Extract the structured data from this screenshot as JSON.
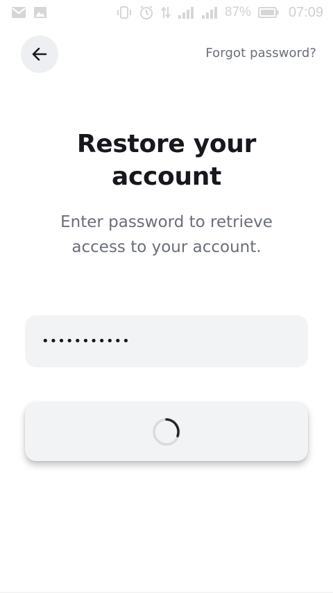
{
  "status_bar": {
    "battery_text": "87%",
    "time": "07:09",
    "icons": [
      "gmail-icon",
      "gallery-icon",
      "vibrate-icon",
      "alarm-icon",
      "data-arrows-icon",
      "signal-icon",
      "signal-icon-2",
      "battery-icon"
    ]
  },
  "header": {
    "back_icon": "arrow-left-icon",
    "forgot_label": "Forgot password?"
  },
  "main": {
    "title": "Restore your account",
    "subtitle": "Enter password to retrieve access to your account.",
    "password_value": "•••••••••••",
    "submit_state": "loading"
  },
  "colors": {
    "title": "#16181d",
    "muted_text": "#6a6e78",
    "field_bg": "#f2f3f5",
    "back_button_bg": "#eeeff2",
    "spinner_track": "#d9dadc",
    "spinner_arc": "#222428"
  }
}
